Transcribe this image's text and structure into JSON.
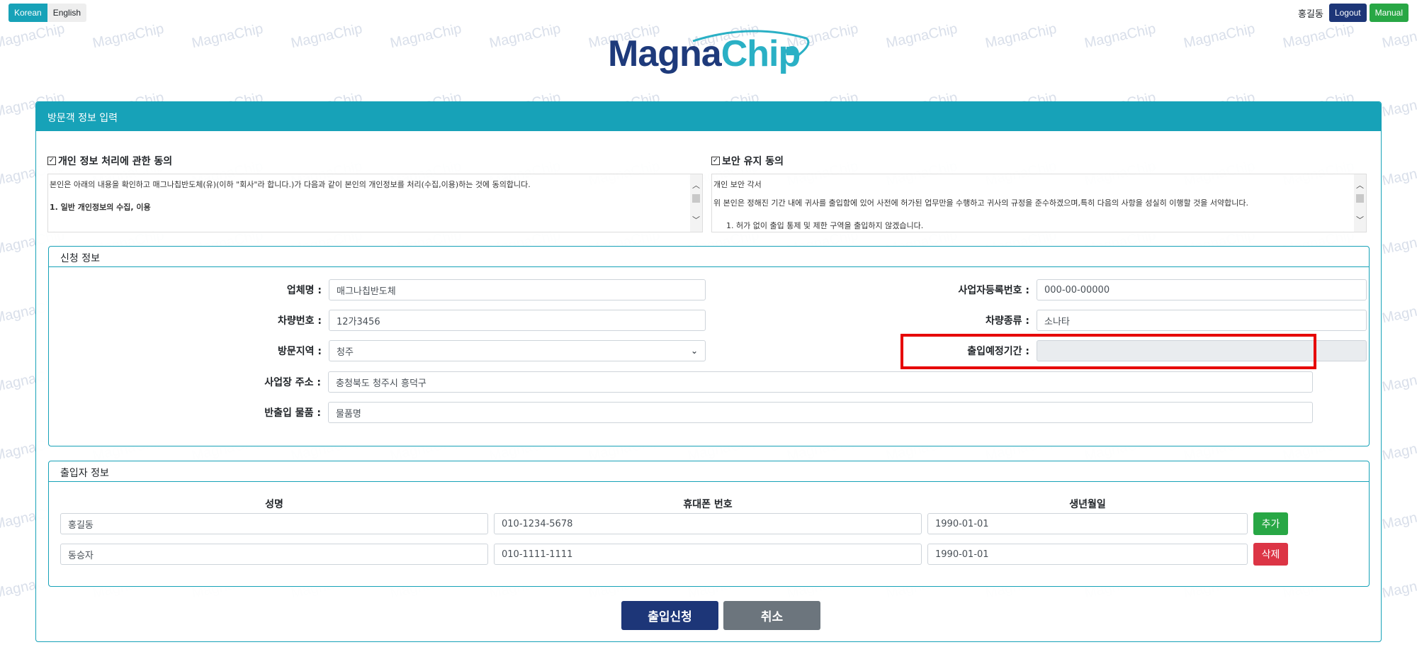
{
  "top": {
    "lang_buttons": [
      "Korean",
      "English"
    ],
    "user_name": "홍길동",
    "logout_label": "Logout",
    "manual_label": "Manual"
  },
  "logo": {
    "part1": "Magna",
    "part2": "Chip",
    "watermark": "MagnaChip"
  },
  "card": {
    "title": "방문객 정보 입력"
  },
  "consent": {
    "privacy": {
      "title": "개인 정보 처리에 관한 동의",
      "checked": true,
      "lines": [
        "본인은 아래의 내용을 확인하고 매그나칩반도체(유)(이하 \"회사\"라 합니다.)가 다음과 같이 본인의 개인정보를 처리(수집,이용)하는 것에 동의합니다.",
        "1. 일반 개인정보의 수집, 이용"
      ]
    },
    "security": {
      "title": "보안 유지 동의",
      "checked": true,
      "lines": [
        "개인 보안 각서",
        "위 본인은 정해진 기간 내에 귀사를 출입함에 있어 사전에 허가된 업무만을 수행하고 귀사의 규정을 준수하겠으며,특히 다음의 사항을 성실히 이행할 것을 서약합니다.",
        "1.  허가 없이 출입 통제 및 제한 구역을 출입하지 않겠습니다."
      ]
    }
  },
  "apply": {
    "legend": "신청 정보",
    "company_label": "업체명 :",
    "company_value": "매그나칩반도체",
    "bizno_label": "사업자등록번호 :",
    "bizno_value": "000-00-00000",
    "car_no_label": "차량번호 :",
    "car_no_value": "12가3456",
    "car_type_label": "차량종류 :",
    "car_type_value": "소나타",
    "region_label": "방문지역 :",
    "region_value": "청주",
    "period_label": "출입예정기간 :",
    "period_value": "",
    "address_label": "사업장 주소 :",
    "address_value": "충청북도 청주시 흥덕구",
    "items_label": "반출입 물품 :",
    "items_value": "물품명"
  },
  "people": {
    "legend": "출입자 정보",
    "headers": [
      "성명",
      "휴대폰 번호",
      "생년월일"
    ],
    "rows": [
      {
        "name": "홍길동",
        "phone": "010-1234-5678",
        "birth": "1990-01-01",
        "action": "추가"
      },
      {
        "name": "동승자",
        "phone": "010-1111-1111",
        "birth": "1990-01-01",
        "action": "삭제"
      }
    ]
  },
  "actions": {
    "submit_label": "출입신청",
    "cancel_label": "취소"
  },
  "colors": {
    "primary_teal": "#17a2b8",
    "navy": "#1d3678",
    "green": "#28a745",
    "red": "#dc3545",
    "gray": "#6c757d",
    "highlight": "#e60000"
  }
}
